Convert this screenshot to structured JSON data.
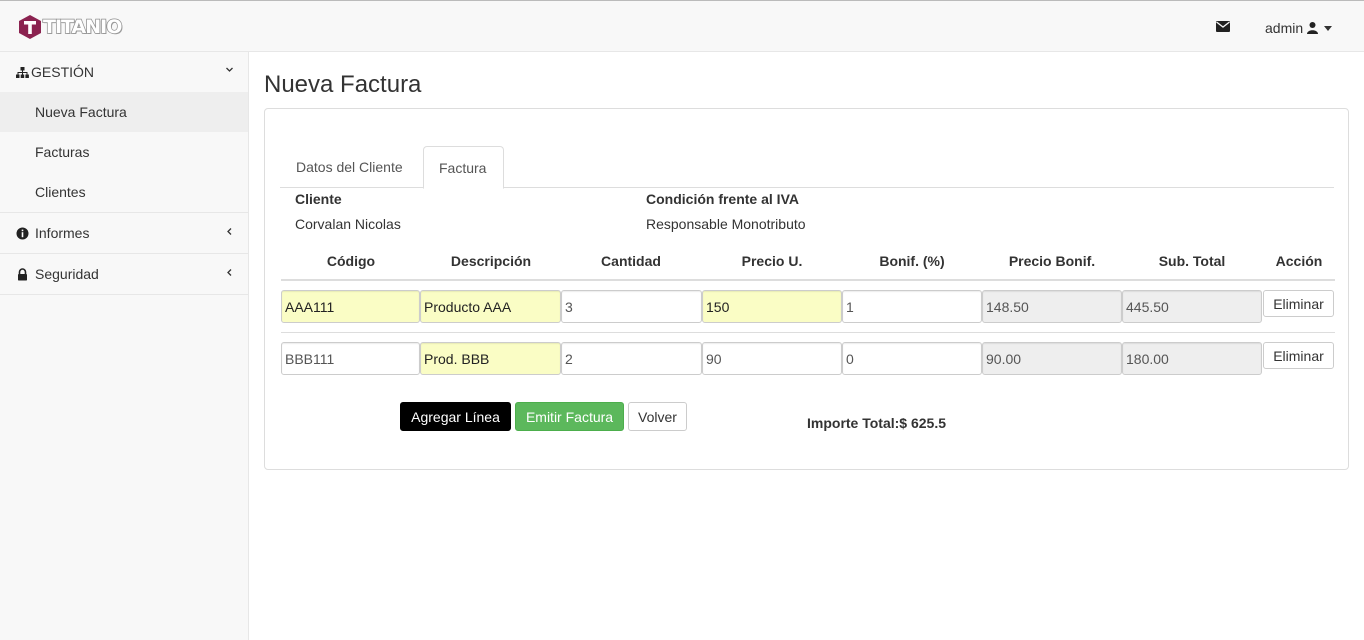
{
  "app": {
    "brand": "TITANIO",
    "brand_color": "#8b2350",
    "user_label": "admin"
  },
  "sidebar": {
    "sections": [
      {
        "label": "GESTIÓN",
        "icon": "sitemap-icon",
        "expanded": true,
        "items": [
          {
            "label": "Nueva Factura",
            "active": true
          },
          {
            "label": "Facturas"
          },
          {
            "label": "Clientes"
          }
        ]
      },
      {
        "label": "Informes",
        "icon": "info-circle-icon",
        "expanded": false
      },
      {
        "label": "Seguridad",
        "icon": "lock-icon",
        "expanded": false
      }
    ]
  },
  "page": {
    "title": "Nueva Factura",
    "tabs": [
      {
        "label": "Datos del Cliente"
      },
      {
        "label": "Factura",
        "active": true
      }
    ],
    "client": {
      "cliente_label": "Cliente",
      "cliente_value": "Corvalan Nicolas",
      "iva_label": "Condición frente al IVA",
      "iva_value": "Responsable Monotributo"
    },
    "table": {
      "headers": [
        "Código",
        "Descripción",
        "Cantidad",
        "Precio U.",
        "Bonif. (%)",
        "Precio Bonif.",
        "Sub. Total",
        "Acción"
      ],
      "rows": [
        {
          "codigo": "AAA111",
          "descripcion": "Producto AAA",
          "cantidad": "3",
          "precio": "150",
          "bonif": "1",
          "precio_bonif": "148.50",
          "subtotal": "445.50",
          "accion": "Eliminar"
        },
        {
          "codigo": "BBB111",
          "descripcion": "Prod. BBB",
          "cantidad": "2",
          "precio": "90",
          "bonif": "0",
          "precio_bonif": "90.00",
          "subtotal": "180.00",
          "accion": "Eliminar"
        }
      ]
    },
    "buttons": {
      "add_line": "Agregar Línea",
      "emit": "Emitir Factura",
      "back": "Volver"
    },
    "total": "Importe Total:$ 625.5"
  }
}
